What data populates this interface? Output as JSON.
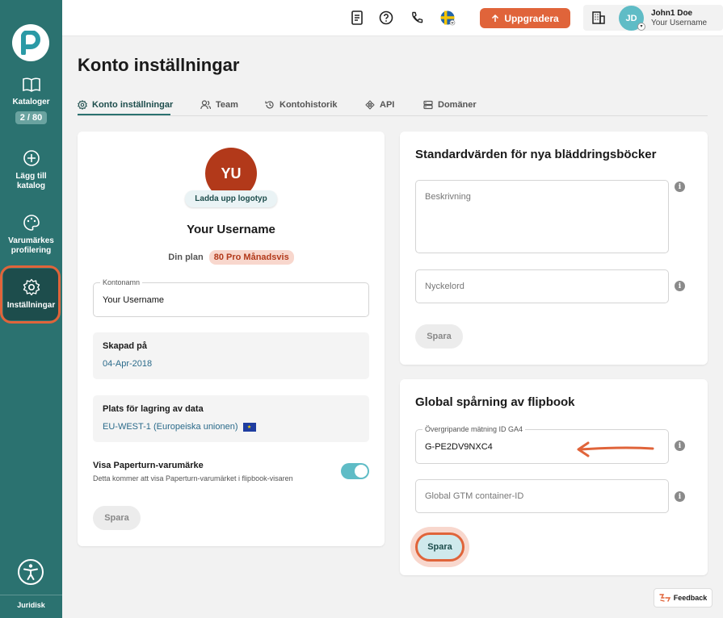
{
  "sidebar": {
    "items": [
      {
        "label": "Kataloger",
        "badge": "2 / 80",
        "icon": "book-open-icon"
      },
      {
        "label": "Lägg till katalog",
        "icon": "plus-circle-icon"
      },
      {
        "label": "Varumärkes profilering",
        "icon": "palette-icon"
      },
      {
        "label": "Inställningar",
        "icon": "gear-icon",
        "active": true
      }
    ],
    "legal": "Juridisk",
    "accessibility_icon": "accessibility-icon"
  },
  "header": {
    "upgrade_label": "Uppgradera",
    "avatar_initials": "JD",
    "user_name": "John1 Doe",
    "user_sub": "Your Username",
    "icons": [
      "document-icon",
      "help-icon",
      "phone-icon",
      "sweden-flag-icon",
      "building-icon"
    ]
  },
  "page": {
    "title": "Konto inställningar",
    "tabs": [
      {
        "label": "Konto inställningar",
        "icon": "gear-icon"
      },
      {
        "label": "Team",
        "icon": "users-icon"
      },
      {
        "label": "Kontohistorik",
        "icon": "history-icon"
      },
      {
        "label": "API",
        "icon": "api-icon"
      },
      {
        "label": "Domäner",
        "icon": "server-icon"
      }
    ]
  },
  "account_card": {
    "logo_initials": "YU",
    "upload_label": "Ladda upp logotyp",
    "username": "Your Username",
    "plan_label": "Din plan",
    "plan_value": "80 Pro Månadsvis",
    "account_name_label": "Kontonamn",
    "account_name_value": "Your Username",
    "created_label": "Skapad på",
    "created_value": "04-Apr-2018",
    "storage_label": "Plats för lagring av data",
    "storage_value": "EU-WEST-1 (Europeiska unionen)",
    "brand_title": "Visa Paperturn-varumärke",
    "brand_desc": "Detta kommer att visa Paperturn-varumärket i flipbook-visaren",
    "brand_enabled": true,
    "save_label": "Spara"
  },
  "defaults_card": {
    "title": "Standardvärden för nya bläddringsböcker",
    "description_placeholder": "Beskrivning",
    "keywords_placeholder": "Nyckelord",
    "save_label": "Spara"
  },
  "tracking_card": {
    "title": "Global spårning av flipbook",
    "ga4_label": "Övergripande mätning ID GA4",
    "ga4_value": "G-PE2DV9NXC4",
    "gtm_placeholder": "Global GTM container-ID",
    "save_label": "Spara"
  },
  "feedback_label": "Feedback",
  "colors": {
    "sidebar": "#2b7270",
    "accent": "#e0643a",
    "teal": "#5fbcc6",
    "logo_bg": "#b2391a"
  }
}
